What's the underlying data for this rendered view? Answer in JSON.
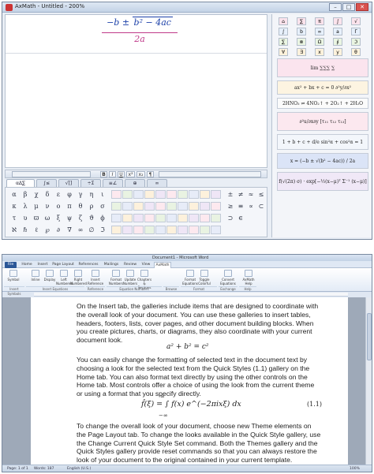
{
  "top_window": {
    "title": "AxMath - Untitled - 200%",
    "controls": {
      "minimize": "–",
      "maximize": "□",
      "close": "✕"
    },
    "formula": {
      "numerator_pre": "−b ± ",
      "numerator_sqrt": "b² − 4ac",
      "denominator": "2a"
    },
    "toolbar": [
      "B",
      "I",
      "U",
      "x²",
      "x₂",
      "¶"
    ],
    "tabs": [
      "αΔ∑",
      "∫≤",
      "√[]",
      "÷Σ",
      "≡∠",
      "⊕",
      "∞"
    ],
    "symbols_row1": [
      "α",
      "β",
      "χ",
      "δ",
      "ε",
      "φ",
      "γ",
      "η",
      "ι"
    ],
    "symbols_row2": [
      "κ",
      "λ",
      "μ",
      "ν",
      "ο",
      "π",
      "θ",
      "ρ",
      "σ"
    ],
    "symbols_row3": [
      "τ",
      "υ",
      "ϖ",
      "ω",
      "ξ",
      "ψ",
      "ζ",
      "ϑ",
      "ϕ"
    ],
    "symbols_row4": [
      "ℵ",
      "ℏ",
      "ℓ",
      "℘",
      "∂",
      "∇",
      "∞",
      "∅",
      "ℑ"
    ],
    "relations": [
      "±",
      "≠",
      "≈",
      "≤",
      "≥",
      "≡",
      "∝",
      "⊂",
      "⊃",
      "∈"
    ],
    "right_panel": {
      "row1": [
        "⌂",
        "∑",
        "π",
        "∫",
        "√"
      ],
      "row2": [
        "∫",
        "b",
        "∞",
        "a",
        "Γ"
      ],
      "row3": [
        "∑",
        "⊗",
        "Ω",
        "∮",
        "ℑ"
      ],
      "row4": [
        "∀",
        "∃",
        "x",
        "y",
        "θ"
      ],
      "examples": [
        "lim   ∑∑∑   ∑",
        "ax² + bx + c = 0    ∂²y/∂x²",
        "2HNO₃ ⇌ 4NO₂↑ + 2O₂↑ + 2H₂O",
        "∂²u/∂x∂y   [τ₁₁ τ₁₂ τ₁₃]",
        "1 + b + c + d/e      sin²α + cos²α = 1",
        "x = (−b ± √(b² − 4ac)) / 2a",
        "f(√(2π) σ) · exp[−½(x−μ)ᵀ Σ⁻¹ (x−μ)]"
      ]
    }
  },
  "word_window": {
    "title": "Document1 - Microsoft Word",
    "tabs": [
      "File",
      "Home",
      "Insert",
      "Page Layout",
      "References",
      "Mailings",
      "Review",
      "View",
      "AxMath"
    ],
    "ribbon_buttons": [
      "Symbol",
      "Inline",
      "Display",
      "Left Numbered",
      "Right Numbered",
      "Insert Reference",
      "Format Numbers",
      "Update Numbers",
      "Chapters & Sections",
      "Format Equations",
      "Toggle Colorful",
      "Convert Equations",
      "AxMath Help"
    ],
    "ribbon_groups": [
      "Insert Symbols",
      "Insert Equations",
      "Reference",
      "Equation Numbers",
      "Browse",
      "Format",
      "Exchange",
      "Help"
    ],
    "paragraph1": "On the Insert tab, the galleries include items that are designed to coordinate with the overall look of your document. You can use these galleries to insert tables, headers, footers, lists, cover pages, and other document building blocks. When you create pictures, charts, or diagrams, they also coordinate with your current document look.",
    "equation1": "a² + b² = c²",
    "paragraph2": "You can easily change the formatting of selected text in the document text by choosing a look for the selected text from the Quick Styles (1.1) gallery on the Home tab. You can also format text directly by using the other controls on the Home tab. Most controls offer a choice of using the look from the current theme or using a format that you specify directly.",
    "equation2": "f̂(ξ) = ∫ f(x) e^(−2πixξ) dx",
    "equation2_limits": {
      "upper": "∞",
      "lower": "−∞"
    },
    "equation2_number": "(1.1)",
    "paragraph3": "To change the overall look of your document, choose new Theme elements on the Page Layout tab. To change the looks available in the Quick Style gallery, use the Change Current Quick Style Set command. Both the Themes gallery and the Quick Styles gallery provide reset commands so that you can always restore the look of your document to the original contained in your current template.",
    "status": {
      "page": "Page: 1 of 1",
      "words": "Words: 187",
      "language": "English (U.S.)",
      "zoom": "100%"
    }
  },
  "colors": {
    "formula_blue": "#1a3fa8",
    "formula_magenta": "#c03a8a",
    "word_blue": "#2b5797"
  }
}
